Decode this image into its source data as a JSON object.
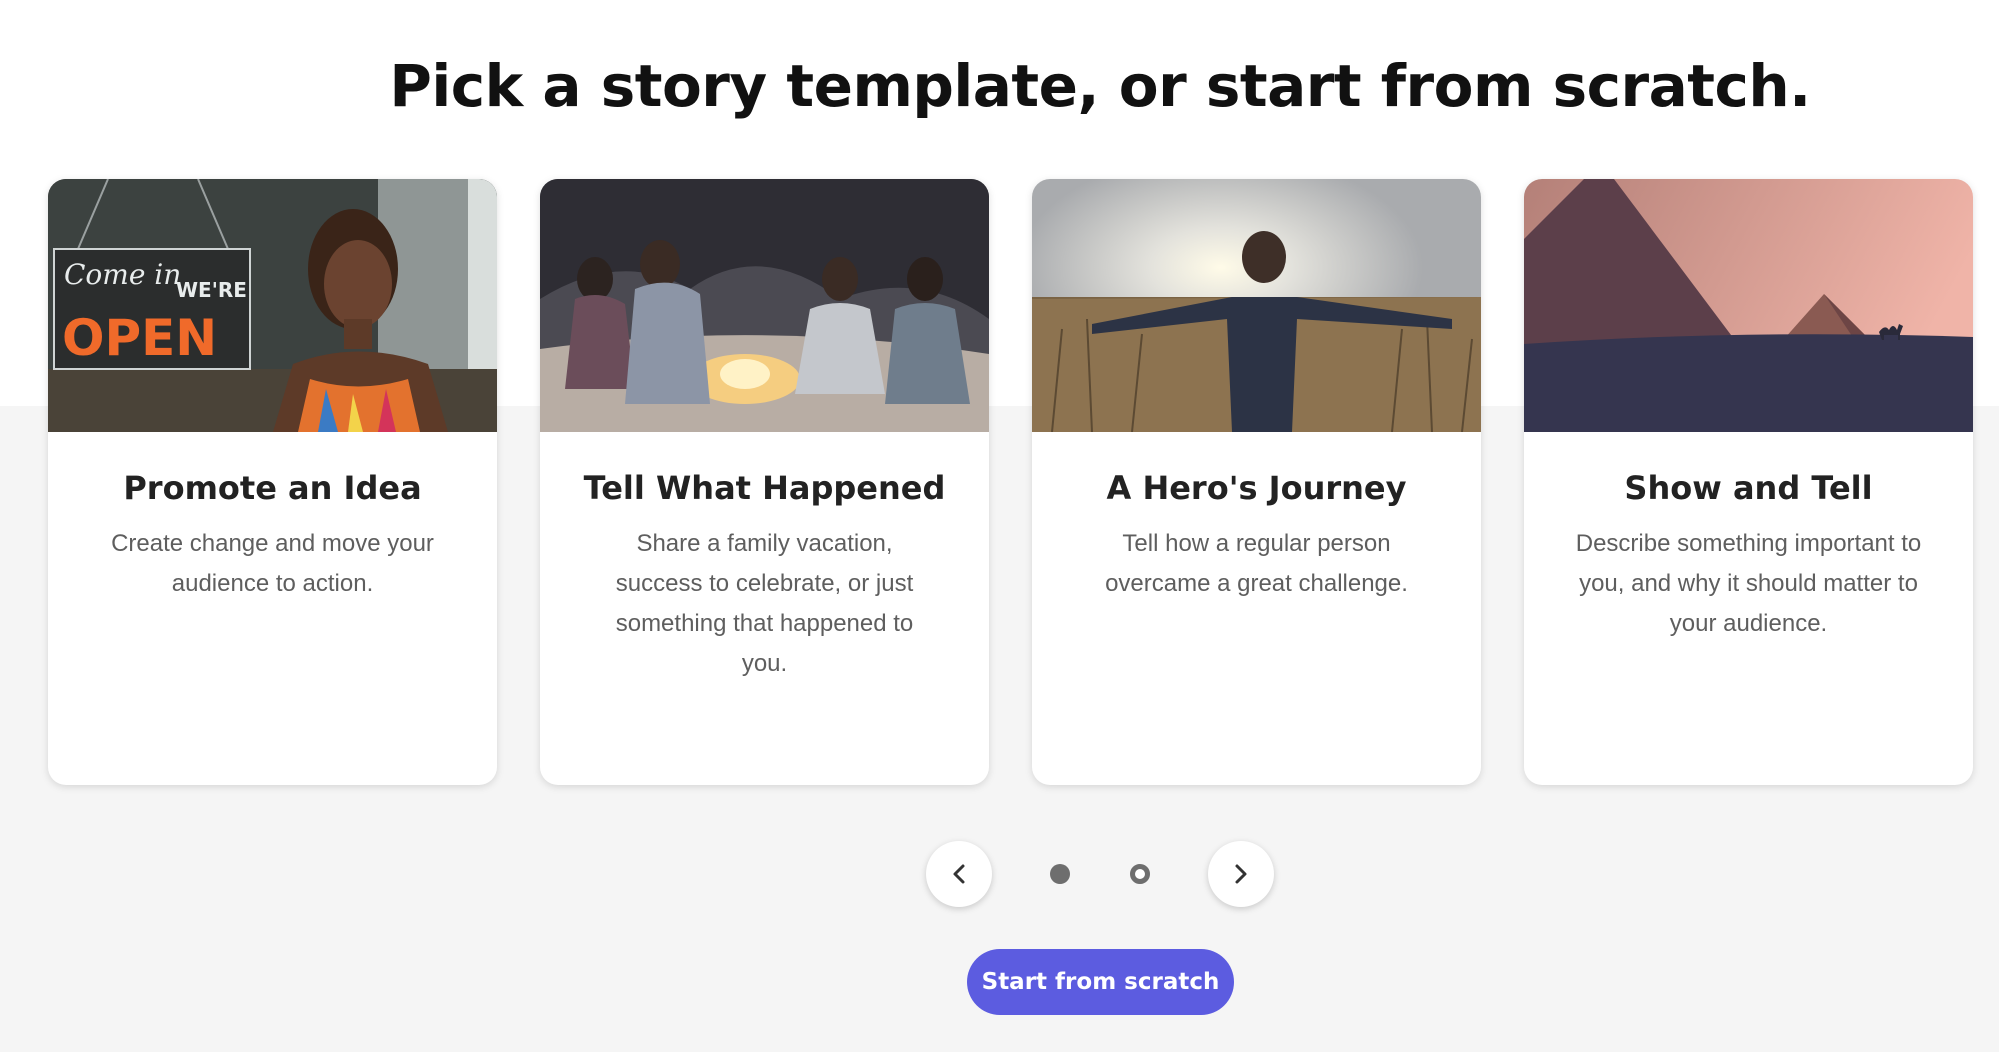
{
  "page": {
    "title": "Pick a story template, or start from scratch."
  },
  "cards": [
    {
      "title": "Promote an Idea",
      "description": "Create change and move your audience to action.",
      "image": {
        "subject": "shop owner behind storefront window with open sign",
        "sign_line1": "Come in",
        "sign_line2": "WE'RE",
        "sign_line3": "OPEN"
      }
    },
    {
      "title": "Tell What Happened",
      "description": "Share a family vacation, success to celebrate, or just something that happened to you.",
      "image": {
        "subject": "friends around a campfire on a beach at dusk"
      }
    },
    {
      "title": "A Hero's Journey",
      "description": "Tell how a regular person overcame a great challenge.",
      "image": {
        "subject": "boy with outstretched arms in a wheat field at sunset"
      }
    },
    {
      "title": "Show and Tell",
      "description": "Describe something important to you, and why it should matter to your audience.",
      "image": {
        "subject": "pyramids and a camel in the desert at dusk"
      }
    }
  ],
  "carousel": {
    "prev_icon": "chevron-left-icon",
    "next_icon": "chevron-right-icon",
    "page_count": 2,
    "active_page": 1
  },
  "cta": {
    "label": "Start from scratch"
  },
  "colors": {
    "accent": "#5c5ce0",
    "background": "#f5f5f5",
    "title": "#111111",
    "card_title": "#222222",
    "card_text": "#5e5e5e"
  }
}
